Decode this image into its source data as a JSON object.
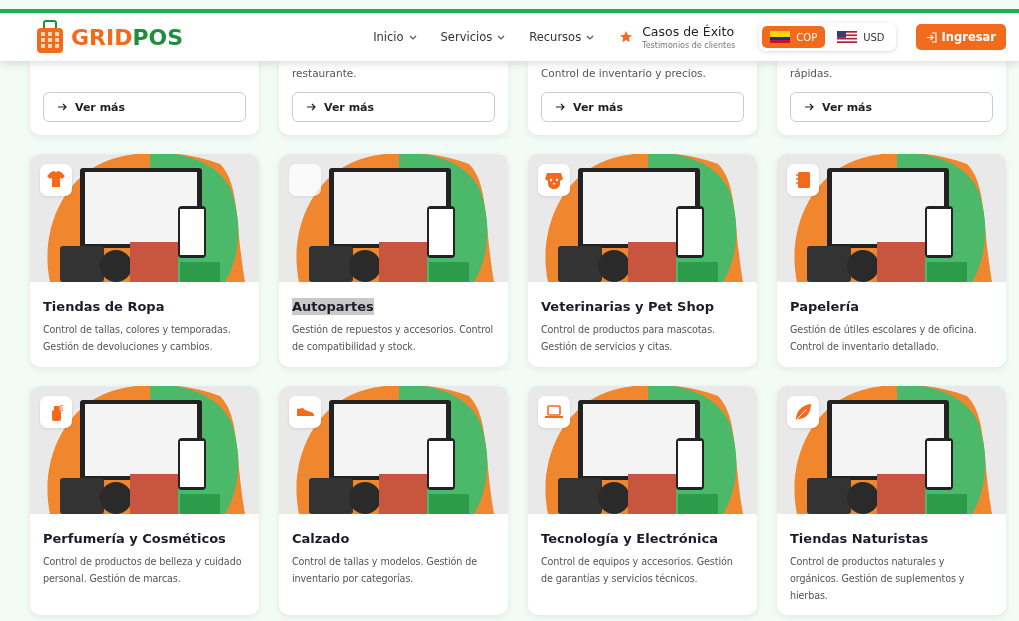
{
  "header": {
    "logo": {
      "part1": "GRID",
      "part2": "POS"
    },
    "nav": [
      {
        "label": "Inicio",
        "dropdown": true
      },
      {
        "label": "Servicios",
        "dropdown": true
      },
      {
        "label": "Recursos",
        "dropdown": true
      }
    ],
    "featured": {
      "title": "Casos de Éxito",
      "subtitle": "Testimonios de clientes"
    },
    "currencies": [
      {
        "code": "COP",
        "kind": "co",
        "selected": true
      },
      {
        "code": "USD",
        "kind": "us",
        "selected": false
      }
    ],
    "login": "Ingresar"
  },
  "top_cards": [
    {
      "button": "Ver más"
    },
    {
      "lines": [
        "restaurante."
      ],
      "button": "Ver más"
    },
    {
      "lines": [
        "Control de inventario y precios."
      ],
      "button": "Ver más"
    },
    {
      "lines": [
        "rápidas."
      ],
      "button": "Ver más"
    }
  ],
  "cards": [
    {
      "kind": "shirt",
      "title": "Tiendas de Ropa",
      "highlighted": false,
      "description": "Control de tallas, colores y temporadas. Gestión de devoluciones y cambios."
    },
    {
      "kind": "blank",
      "title": "Autopartes",
      "highlighted": true,
      "description": "Gestión de repuestos y accesorios. Control de compatibilidad y stock."
    },
    {
      "kind": "dog",
      "title": "Veterinarias y Pet Shop",
      "highlighted": false,
      "description": "Control de productos para mascotas. Gestión de servicios y citas."
    },
    {
      "kind": "notebook",
      "title": "Papelería",
      "highlighted": false,
      "description": "Gestión de útiles escolares y de oficina. Control de inventario detallado."
    },
    {
      "kind": "spray",
      "title": "Perfumería y Cosméticos",
      "highlighted": false,
      "description": "Control de productos de belleza y cuidado personal. Gestión de marcas."
    },
    {
      "kind": "shoe",
      "title": "Calzado",
      "highlighted": false,
      "description": "Control de tallas y modelos. Gestión de inventario por categorías."
    },
    {
      "kind": "laptop",
      "title": "Tecnología y Electrónica",
      "highlighted": false,
      "description": "Control de equipos y accesorios. Gestión de garantías y servicios técnicos."
    },
    {
      "kind": "leaf",
      "title": "Tiendas Naturistas",
      "highlighted": false,
      "description": "Control de productos naturales y orgánicos. Gestión de suplementos y hierbas."
    }
  ]
}
